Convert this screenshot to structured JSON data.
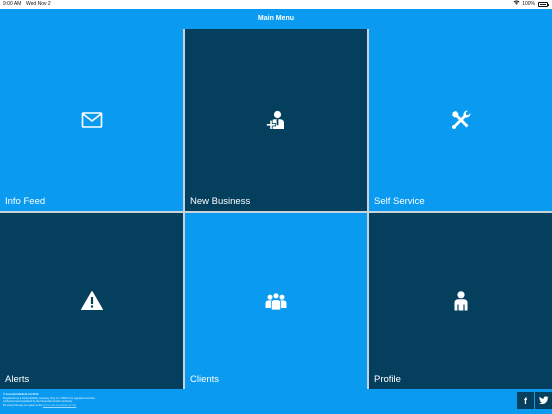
{
  "status_bar": {
    "time": "9:00 AM",
    "date": "Wed Nov 2",
    "battery": "100%"
  },
  "header": {
    "title": "Main Menu"
  },
  "tiles": [
    {
      "label": "Info Feed",
      "icon": "envelope-icon"
    },
    {
      "label": "New Business",
      "icon": "business-person-add-icon"
    },
    {
      "label": "Self Service",
      "icon": "tools-icon"
    },
    {
      "label": "Alerts",
      "icon": "warning-icon"
    },
    {
      "label": "Clients",
      "icon": "group-icon"
    },
    {
      "label": "Profile",
      "icon": "person-icon"
    }
  ],
  "footer": {
    "copyright": "© Assurant Medical Ltd 2016",
    "line1": "Registered as a limited liability company. Reg no. 7384 for its regulated services.",
    "line2": "Authorised and regulated by the Financial Conduct Authority.",
    "line3_prefix": "By using this app you agree to the",
    "line3_link": "Terms and Conditions of Use",
    "facebook": "f"
  },
  "colors": {
    "accent": "#0a9bf0",
    "dark_tile": "#04405e",
    "divider": "#c9d3d9"
  }
}
